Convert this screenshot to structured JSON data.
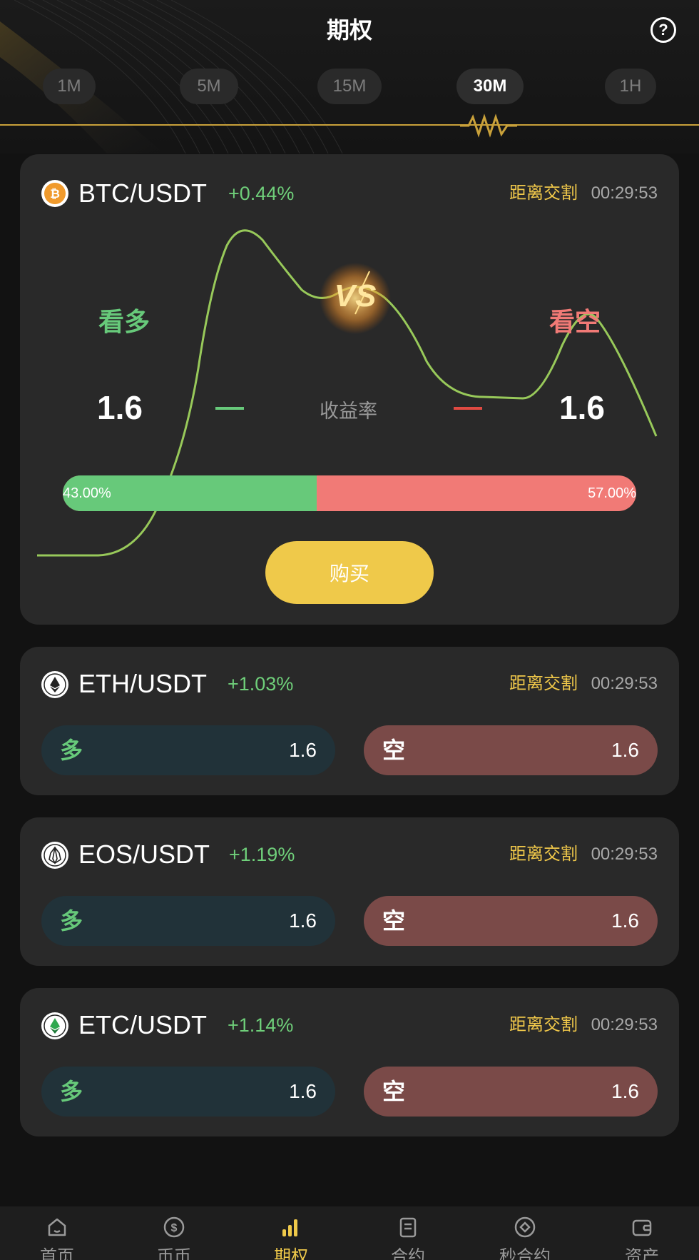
{
  "header": {
    "title": "期权",
    "help_symbol": "?"
  },
  "tabs": [
    {
      "label": "1M",
      "active": false
    },
    {
      "label": "5M",
      "active": false
    },
    {
      "label": "15M",
      "active": false
    },
    {
      "label": "30M",
      "active": true
    },
    {
      "label": "1H",
      "active": false
    }
  ],
  "featured": {
    "pair": "BTC/USDT",
    "change": "+0.44%",
    "deliver_label": "距离交割",
    "deliver_time": "00:29:53",
    "long_label": "看多",
    "short_label": "看空",
    "long_value": "1.6",
    "short_value": "1.6",
    "rate_label": "收益率",
    "vs_label": "VS",
    "long_percent_text": "43.00%",
    "short_percent_text": "57.00%",
    "long_fraction": 0.43,
    "buy_label": "购买",
    "icon": "bitcoin-icon"
  },
  "cards": [
    {
      "pair": "ETH/USDT",
      "change": "+1.03%",
      "deliver_label": "距离交割",
      "deliver_time": "00:29:53",
      "long_label": "多",
      "long_value": "1.6",
      "short_label": "空",
      "short_value": "1.6",
      "icon": "ethereum-icon"
    },
    {
      "pair": "EOS/USDT",
      "change": "+1.19%",
      "deliver_label": "距离交割",
      "deliver_time": "00:29:53",
      "long_label": "多",
      "long_value": "1.6",
      "short_label": "空",
      "short_value": "1.6",
      "icon": "eos-icon"
    },
    {
      "pair": "ETC/USDT",
      "change": "+1.14%",
      "deliver_label": "距离交割",
      "deliver_time": "00:29:53",
      "long_label": "多",
      "long_value": "1.6",
      "short_label": "空",
      "short_value": "1.6",
      "icon": "ethereum-classic-icon"
    }
  ],
  "nav": [
    {
      "label": "首页",
      "icon": "home-icon",
      "active": false
    },
    {
      "label": "币币",
      "icon": "dollar-coin-icon",
      "active": false
    },
    {
      "label": "期权",
      "icon": "bar-chart-icon",
      "active": true
    },
    {
      "label": "合约",
      "icon": "document-icon",
      "active": false
    },
    {
      "label": "秒合约",
      "icon": "diamond-icon",
      "active": false
    },
    {
      "label": "资产",
      "icon": "wallet-icon",
      "active": false
    }
  ],
  "colors": {
    "background": "#121212",
    "card": "#292929",
    "accent_gold": "#efc94a",
    "up_green": "#67c97a",
    "down_red": "#f17a76"
  }
}
